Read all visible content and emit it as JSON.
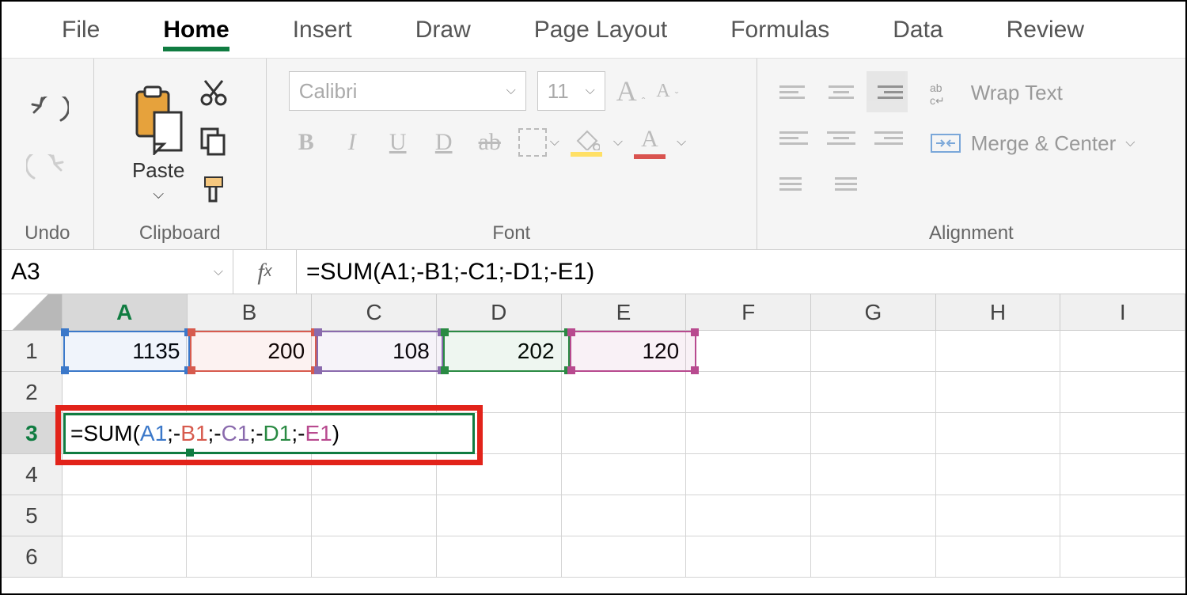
{
  "tabs": {
    "file": "File",
    "home": "Home",
    "insert": "Insert",
    "draw": "Draw",
    "page_layout": "Page Layout",
    "formulas": "Formulas",
    "data": "Data",
    "review": "Review"
  },
  "ribbon": {
    "undo_group": "Undo",
    "clipboard_group": "Clipboard",
    "paste_label": "Paste",
    "font_group": "Font",
    "font_name": "Calibri",
    "font_size": "11",
    "alignment_group": "Alignment",
    "wrap_text": "Wrap Text",
    "merge_center": "Merge & Center"
  },
  "name_box": "A3",
  "fx_label": "fx",
  "formula_bar": "=SUM(A1;-B1;-C1;-D1;-E1)",
  "columns": [
    "A",
    "B",
    "C",
    "D",
    "E",
    "F",
    "G",
    "H",
    "I"
  ],
  "rows": [
    "1",
    "2",
    "3",
    "4",
    "5",
    "6"
  ],
  "cells": {
    "A1": "1135",
    "B1": "200",
    "C1": "108",
    "D1": "202",
    "E1": "120"
  },
  "edit_cell": {
    "prefix": "=SUM(",
    "a": "A1",
    "sep1": ";-",
    "b": "B1",
    "sep2": ";-",
    "c": "C1",
    "sep3": ";-",
    "d": "D1",
    "sep4": ";-",
    "e": "E1",
    "suffix": ")"
  }
}
